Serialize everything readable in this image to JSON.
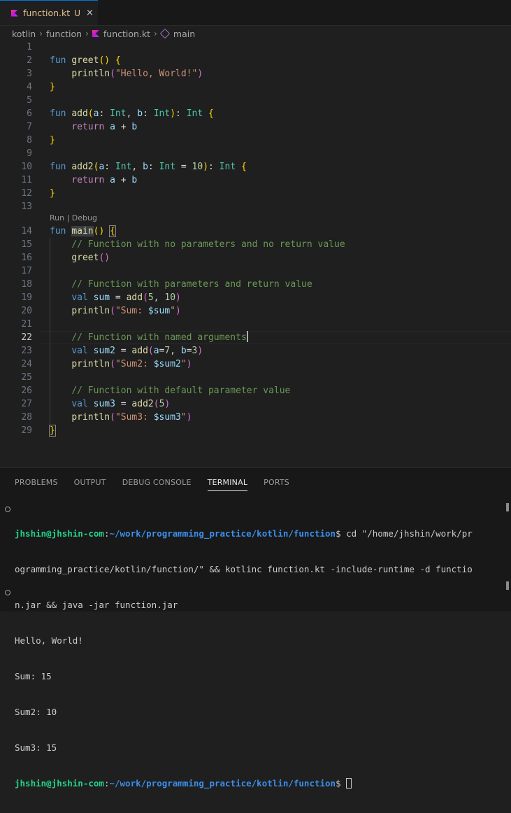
{
  "tab": {
    "filename": "function.kt",
    "status": "U",
    "close": "×"
  },
  "breadcrumb": {
    "items": [
      "kotlin",
      "function",
      "function.kt",
      "main"
    ],
    "sep": "›"
  },
  "editor": {
    "codelens": "Run | Debug",
    "active_line": 22,
    "lines": [
      {
        "n": "1",
        "tokens": []
      },
      {
        "n": "2",
        "tokens": [
          {
            "t": "fun ",
            "c": "kw"
          },
          {
            "t": "greet",
            "c": "fn"
          },
          {
            "t": "()",
            "c": "p1"
          },
          {
            "t": " ",
            "c": "pl"
          },
          {
            "t": "{",
            "c": "p1"
          }
        ]
      },
      {
        "n": "3",
        "tokens": [
          {
            "t": "    ",
            "c": "pl"
          },
          {
            "t": "println",
            "c": "fn"
          },
          {
            "t": "(",
            "c": "p2"
          },
          {
            "t": "\"Hello, World!\"",
            "c": "str"
          },
          {
            "t": ")",
            "c": "p2"
          }
        ]
      },
      {
        "n": "4",
        "tokens": [
          {
            "t": "}",
            "c": "p1"
          }
        ]
      },
      {
        "n": "5",
        "tokens": []
      },
      {
        "n": "6",
        "tokens": [
          {
            "t": "fun ",
            "c": "kw"
          },
          {
            "t": "add",
            "c": "fn"
          },
          {
            "t": "(",
            "c": "p1"
          },
          {
            "t": "a",
            "c": "var"
          },
          {
            "t": ": ",
            "c": "pl"
          },
          {
            "t": "Int",
            "c": "type"
          },
          {
            "t": ", ",
            "c": "pl"
          },
          {
            "t": "b",
            "c": "var"
          },
          {
            "t": ": ",
            "c": "pl"
          },
          {
            "t": "Int",
            "c": "type"
          },
          {
            "t": ")",
            "c": "p1"
          },
          {
            "t": ": ",
            "c": "pl"
          },
          {
            "t": "Int",
            "c": "type"
          },
          {
            "t": " ",
            "c": "pl"
          },
          {
            "t": "{",
            "c": "p1"
          }
        ]
      },
      {
        "n": "7",
        "tokens": [
          {
            "t": "    ",
            "c": "pl"
          },
          {
            "t": "return ",
            "c": "ctl"
          },
          {
            "t": "a",
            "c": "var"
          },
          {
            "t": " + ",
            "c": "pl"
          },
          {
            "t": "b",
            "c": "var"
          }
        ]
      },
      {
        "n": "8",
        "tokens": [
          {
            "t": "}",
            "c": "p1"
          }
        ]
      },
      {
        "n": "9",
        "tokens": []
      },
      {
        "n": "10",
        "tokens": [
          {
            "t": "fun ",
            "c": "kw"
          },
          {
            "t": "add2",
            "c": "fn"
          },
          {
            "t": "(",
            "c": "p1"
          },
          {
            "t": "a",
            "c": "var"
          },
          {
            "t": ": ",
            "c": "pl"
          },
          {
            "t": "Int",
            "c": "type"
          },
          {
            "t": ", ",
            "c": "pl"
          },
          {
            "t": "b",
            "c": "var"
          },
          {
            "t": ": ",
            "c": "pl"
          },
          {
            "t": "Int",
            "c": "type"
          },
          {
            "t": " = ",
            "c": "pl"
          },
          {
            "t": "10",
            "c": "num"
          },
          {
            "t": ")",
            "c": "p1"
          },
          {
            "t": ": ",
            "c": "pl"
          },
          {
            "t": "Int",
            "c": "type"
          },
          {
            "t": " ",
            "c": "pl"
          },
          {
            "t": "{",
            "c": "p1"
          }
        ]
      },
      {
        "n": "11",
        "tokens": [
          {
            "t": "    ",
            "c": "pl"
          },
          {
            "t": "return ",
            "c": "ctl"
          },
          {
            "t": "a",
            "c": "var"
          },
          {
            "t": " + ",
            "c": "pl"
          },
          {
            "t": "b",
            "c": "var"
          }
        ]
      },
      {
        "n": "12",
        "tokens": [
          {
            "t": "}",
            "c": "p1"
          }
        ]
      },
      {
        "n": "13",
        "tokens": []
      },
      {
        "n": "14",
        "tokens": [
          {
            "t": "fun ",
            "c": "kw"
          },
          {
            "t": "main",
            "c": "fn",
            "hl": true
          },
          {
            "t": "()",
            "c": "p1"
          },
          {
            "t": " ",
            "c": "pl"
          },
          {
            "t": "{",
            "c": "p1",
            "bm": true
          }
        ]
      },
      {
        "n": "15",
        "tokens": [
          {
            "t": "    ",
            "c": "pl"
          },
          {
            "t": "// Function with no parameters and no return value",
            "c": "cmt"
          }
        ]
      },
      {
        "n": "16",
        "tokens": [
          {
            "t": "    ",
            "c": "pl"
          },
          {
            "t": "greet",
            "c": "fn"
          },
          {
            "t": "()",
            "c": "p2"
          }
        ]
      },
      {
        "n": "17",
        "tokens": []
      },
      {
        "n": "18",
        "tokens": [
          {
            "t": "    ",
            "c": "pl"
          },
          {
            "t": "// Function with parameters and return value",
            "c": "cmt"
          }
        ]
      },
      {
        "n": "19",
        "tokens": [
          {
            "t": "    ",
            "c": "pl"
          },
          {
            "t": "val ",
            "c": "kw"
          },
          {
            "t": "sum",
            "c": "var"
          },
          {
            "t": " = ",
            "c": "pl"
          },
          {
            "t": "add",
            "c": "fn"
          },
          {
            "t": "(",
            "c": "p2"
          },
          {
            "t": "5",
            "c": "num"
          },
          {
            "t": ", ",
            "c": "pl"
          },
          {
            "t": "10",
            "c": "num"
          },
          {
            "t": ")",
            "c": "p2"
          }
        ]
      },
      {
        "n": "20",
        "tokens": [
          {
            "t": "    ",
            "c": "pl"
          },
          {
            "t": "println",
            "c": "fn"
          },
          {
            "t": "(",
            "c": "p2"
          },
          {
            "t": "\"Sum: ",
            "c": "str"
          },
          {
            "t": "$sum",
            "c": "var"
          },
          {
            "t": "\"",
            "c": "str"
          },
          {
            "t": ")",
            "c": "p2"
          }
        ]
      },
      {
        "n": "21",
        "tokens": []
      },
      {
        "n": "22",
        "tokens": [
          {
            "t": "    ",
            "c": "pl"
          },
          {
            "t": "// Function with named arguments",
            "c": "cmt"
          }
        ],
        "cursor": true
      },
      {
        "n": "23",
        "tokens": [
          {
            "t": "    ",
            "c": "pl"
          },
          {
            "t": "val ",
            "c": "kw"
          },
          {
            "t": "sum2",
            "c": "var"
          },
          {
            "t": " = ",
            "c": "pl"
          },
          {
            "t": "add",
            "c": "fn"
          },
          {
            "t": "(",
            "c": "p2"
          },
          {
            "t": "a",
            "c": "var"
          },
          {
            "t": "=",
            "c": "pl"
          },
          {
            "t": "7",
            "c": "num"
          },
          {
            "t": ", ",
            "c": "pl"
          },
          {
            "t": "b",
            "c": "var"
          },
          {
            "t": "=",
            "c": "pl"
          },
          {
            "t": "3",
            "c": "num"
          },
          {
            "t": ")",
            "c": "p2"
          }
        ]
      },
      {
        "n": "24",
        "tokens": [
          {
            "t": "    ",
            "c": "pl"
          },
          {
            "t": "println",
            "c": "fn"
          },
          {
            "t": "(",
            "c": "p2"
          },
          {
            "t": "\"Sum2: ",
            "c": "str"
          },
          {
            "t": "$sum2",
            "c": "var"
          },
          {
            "t": "\"",
            "c": "str"
          },
          {
            "t": ")",
            "c": "p2"
          }
        ]
      },
      {
        "n": "25",
        "tokens": []
      },
      {
        "n": "26",
        "tokens": [
          {
            "t": "    ",
            "c": "pl"
          },
          {
            "t": "// Function with default parameter value",
            "c": "cmt"
          }
        ]
      },
      {
        "n": "27",
        "tokens": [
          {
            "t": "    ",
            "c": "pl"
          },
          {
            "t": "val ",
            "c": "kw"
          },
          {
            "t": "sum3",
            "c": "var"
          },
          {
            "t": " = ",
            "c": "pl"
          },
          {
            "t": "add2",
            "c": "fn"
          },
          {
            "t": "(",
            "c": "p2"
          },
          {
            "t": "5",
            "c": "num"
          },
          {
            "t": ")",
            "c": "p2"
          }
        ]
      },
      {
        "n": "28",
        "tokens": [
          {
            "t": "    ",
            "c": "pl"
          },
          {
            "t": "println",
            "c": "fn"
          },
          {
            "t": "(",
            "c": "p2"
          },
          {
            "t": "\"Sum3: ",
            "c": "str"
          },
          {
            "t": "$sum3",
            "c": "var"
          },
          {
            "t": "\"",
            "c": "str"
          },
          {
            "t": ")",
            "c": "p2"
          }
        ]
      },
      {
        "n": "29",
        "tokens": [
          {
            "t": "}",
            "c": "p1",
            "bm": true
          }
        ]
      }
    ]
  },
  "panel": {
    "tabs": [
      {
        "label": "PROBLEMS",
        "active": false
      },
      {
        "label": "OUTPUT",
        "active": false
      },
      {
        "label": "DEBUG CONSOLE",
        "active": false
      },
      {
        "label": "TERMINAL",
        "active": true
      },
      {
        "label": "PORTS",
        "active": false
      }
    ]
  },
  "terminal": {
    "prompt_user": "jhshin@jhshin-com",
    "prompt_path": "~/work/programming_practice/kotlin/function",
    "prompt_symbol": "$",
    "command": " cd \"/home/jhshin/work/pr",
    "command_wrap1": "ogramming_practice/kotlin/function/\" && kotlinc function.kt -include-runtime -d functio",
    "command_wrap2": "n.jar && java -jar function.jar",
    "output": [
      "Hello, World!",
      "Sum: 15",
      "Sum2: 10",
      "Sum3: 15"
    ]
  },
  "colors": {
    "accent": "#0078d4",
    "modified": "#e2c08d",
    "prompt_user": "#23d18b",
    "prompt_path": "#3b8eea"
  }
}
